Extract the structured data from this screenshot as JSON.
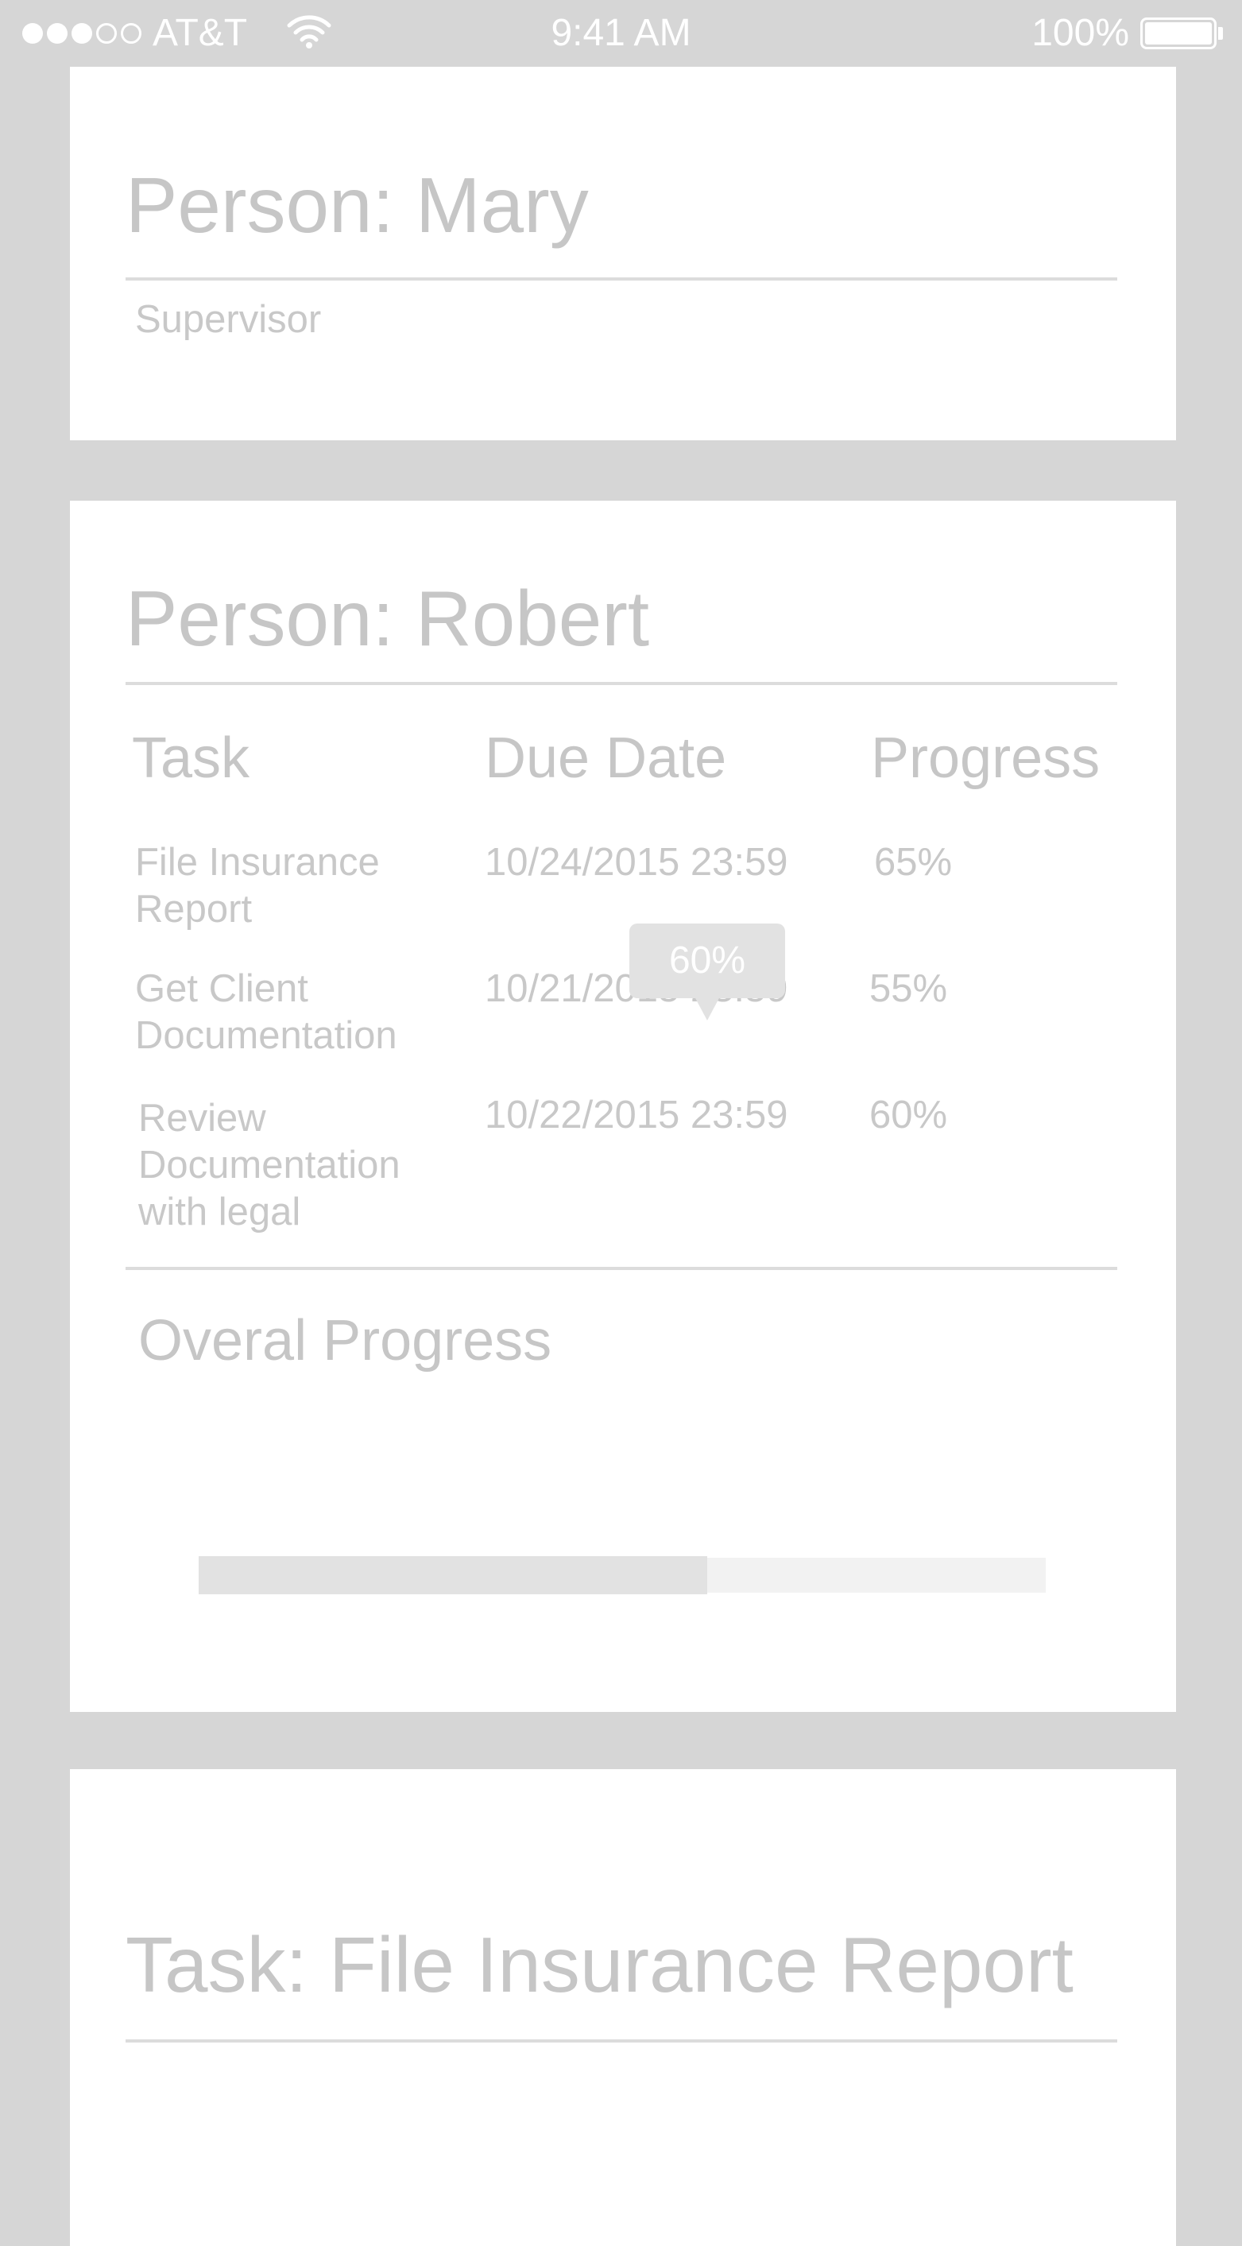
{
  "status_bar": {
    "carrier": "AT&T",
    "time": "9:41 AM",
    "battery": "100%",
    "signal_bars_filled": 3,
    "signal_bars_total": 5
  },
  "mary_card": {
    "label": "Person:",
    "name": "Mary",
    "role": "Supervisor"
  },
  "robert_card": {
    "label": "Person:",
    "name": "Robert",
    "columns": [
      "Task",
      "Due Date",
      "Progress"
    ],
    "rows": [
      {
        "task": "File Insurance Report",
        "due": "10/24/2015  23:59",
        "progress": "65%"
      },
      {
        "task": "Get Client Documentation",
        "due": "10/21/2015  23:59",
        "progress": "55%"
      },
      {
        "task": "Review Documentation with legal",
        "due": "10/22/2015  23:59",
        "progress": "60%"
      }
    ],
    "overall_label": "Overal Progress",
    "overall_value": "60%",
    "overall_fraction": 0.6
  },
  "task_card": {
    "label": "Task:",
    "name": "File Insurance Report"
  },
  "colors": {
    "background": "#d6d6d6",
    "card": "#ffffff",
    "text": "#c6c6c6",
    "progress_fill": "#e2e2e2",
    "progress_track": "#f2f2f2"
  }
}
